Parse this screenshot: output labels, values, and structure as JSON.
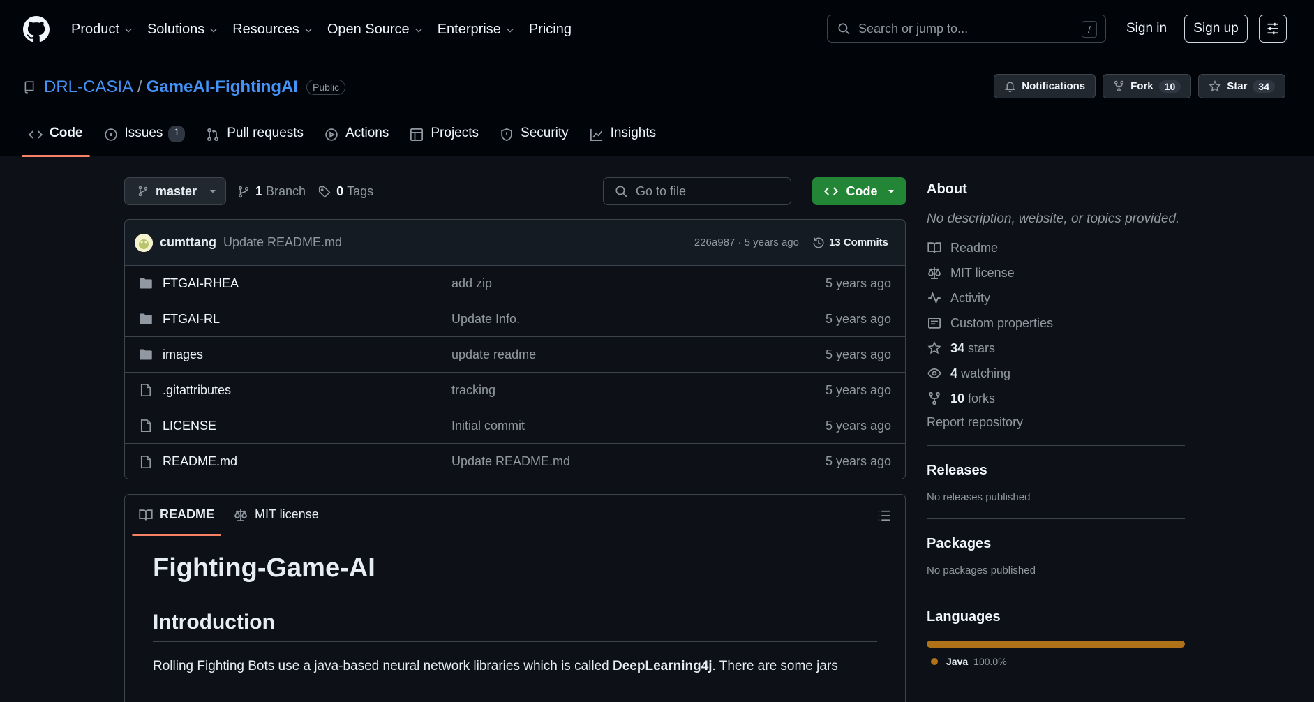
{
  "header": {
    "nav": [
      "Product",
      "Solutions",
      "Resources",
      "Open Source",
      "Enterprise",
      "Pricing"
    ],
    "search_placeholder": "Search or jump to...",
    "search_shortcut": "/",
    "signin": "Sign in",
    "signup": "Sign up"
  },
  "repo": {
    "owner": "DRL-CASIA",
    "separator": "/",
    "name": "GameAI-FightingAI",
    "visibility": "Public",
    "notifications": "Notifications",
    "fork_label": "Fork",
    "fork_count": "10",
    "star_label": "Star",
    "star_count": "34"
  },
  "tabs": [
    {
      "label": "Code",
      "active": true
    },
    {
      "label": "Issues",
      "count": "1"
    },
    {
      "label": "Pull requests"
    },
    {
      "label": "Actions"
    },
    {
      "label": "Projects"
    },
    {
      "label": "Security"
    },
    {
      "label": "Insights"
    }
  ],
  "toolbar": {
    "branch": "master",
    "branch_count": "1",
    "branch_label": "Branch",
    "tag_count": "0",
    "tag_label": "Tags",
    "goto_placeholder": "Go to file",
    "code_button": "Code"
  },
  "latest_commit": {
    "author": "cumttang",
    "message": "Update README.md",
    "meta": "226a987 · 5 years ago",
    "commits": "13 Commits"
  },
  "files": [
    {
      "name": "FTGAI-RHEA",
      "type": "folder",
      "message": "add zip",
      "date": "5 years ago"
    },
    {
      "name": "FTGAI-RL",
      "type": "folder",
      "message": "Update Info.",
      "date": "5 years ago"
    },
    {
      "name": "images",
      "type": "folder",
      "message": "update readme",
      "date": "5 years ago"
    },
    {
      "name": ".gitattributes",
      "type": "file",
      "message": "tracking",
      "date": "5 years ago"
    },
    {
      "name": "LICENSE",
      "type": "file",
      "message": "Initial commit",
      "date": "5 years ago"
    },
    {
      "name": "README.md",
      "type": "file",
      "message": "Update README.md",
      "date": "5 years ago"
    }
  ],
  "readme": {
    "tab_readme": "README",
    "tab_license": "MIT license",
    "h1": "Fighting-Game-AI",
    "h2": "Introduction",
    "p_before": "Rolling Fighting Bots use a java-based neural network libraries which is called ",
    "p_bold": "DeepLearning4j",
    "p_after": ". There are some jars"
  },
  "about": {
    "title": "About",
    "description": "No description, website, or topics provided.",
    "readme": "Readme",
    "license": "MIT license",
    "activity": "Activity",
    "custom_properties": "Custom properties",
    "stars_count": "34",
    "stars_label": "stars",
    "watching_count": "4",
    "watching_label": "watching",
    "forks_count": "10",
    "forks_label": "forks",
    "report": "Report repository"
  },
  "releases": {
    "title": "Releases",
    "text": "No releases published"
  },
  "packages": {
    "title": "Packages",
    "text": "No packages published"
  },
  "languages": {
    "title": "Languages",
    "items": [
      {
        "name": "Java",
        "percent": "100.0%",
        "color": "#b07219"
      }
    ]
  },
  "colors": {
    "accent_link": "#4493f8",
    "tab_underline": "#f78166",
    "code_button": "#238636",
    "java": "#b07219"
  }
}
